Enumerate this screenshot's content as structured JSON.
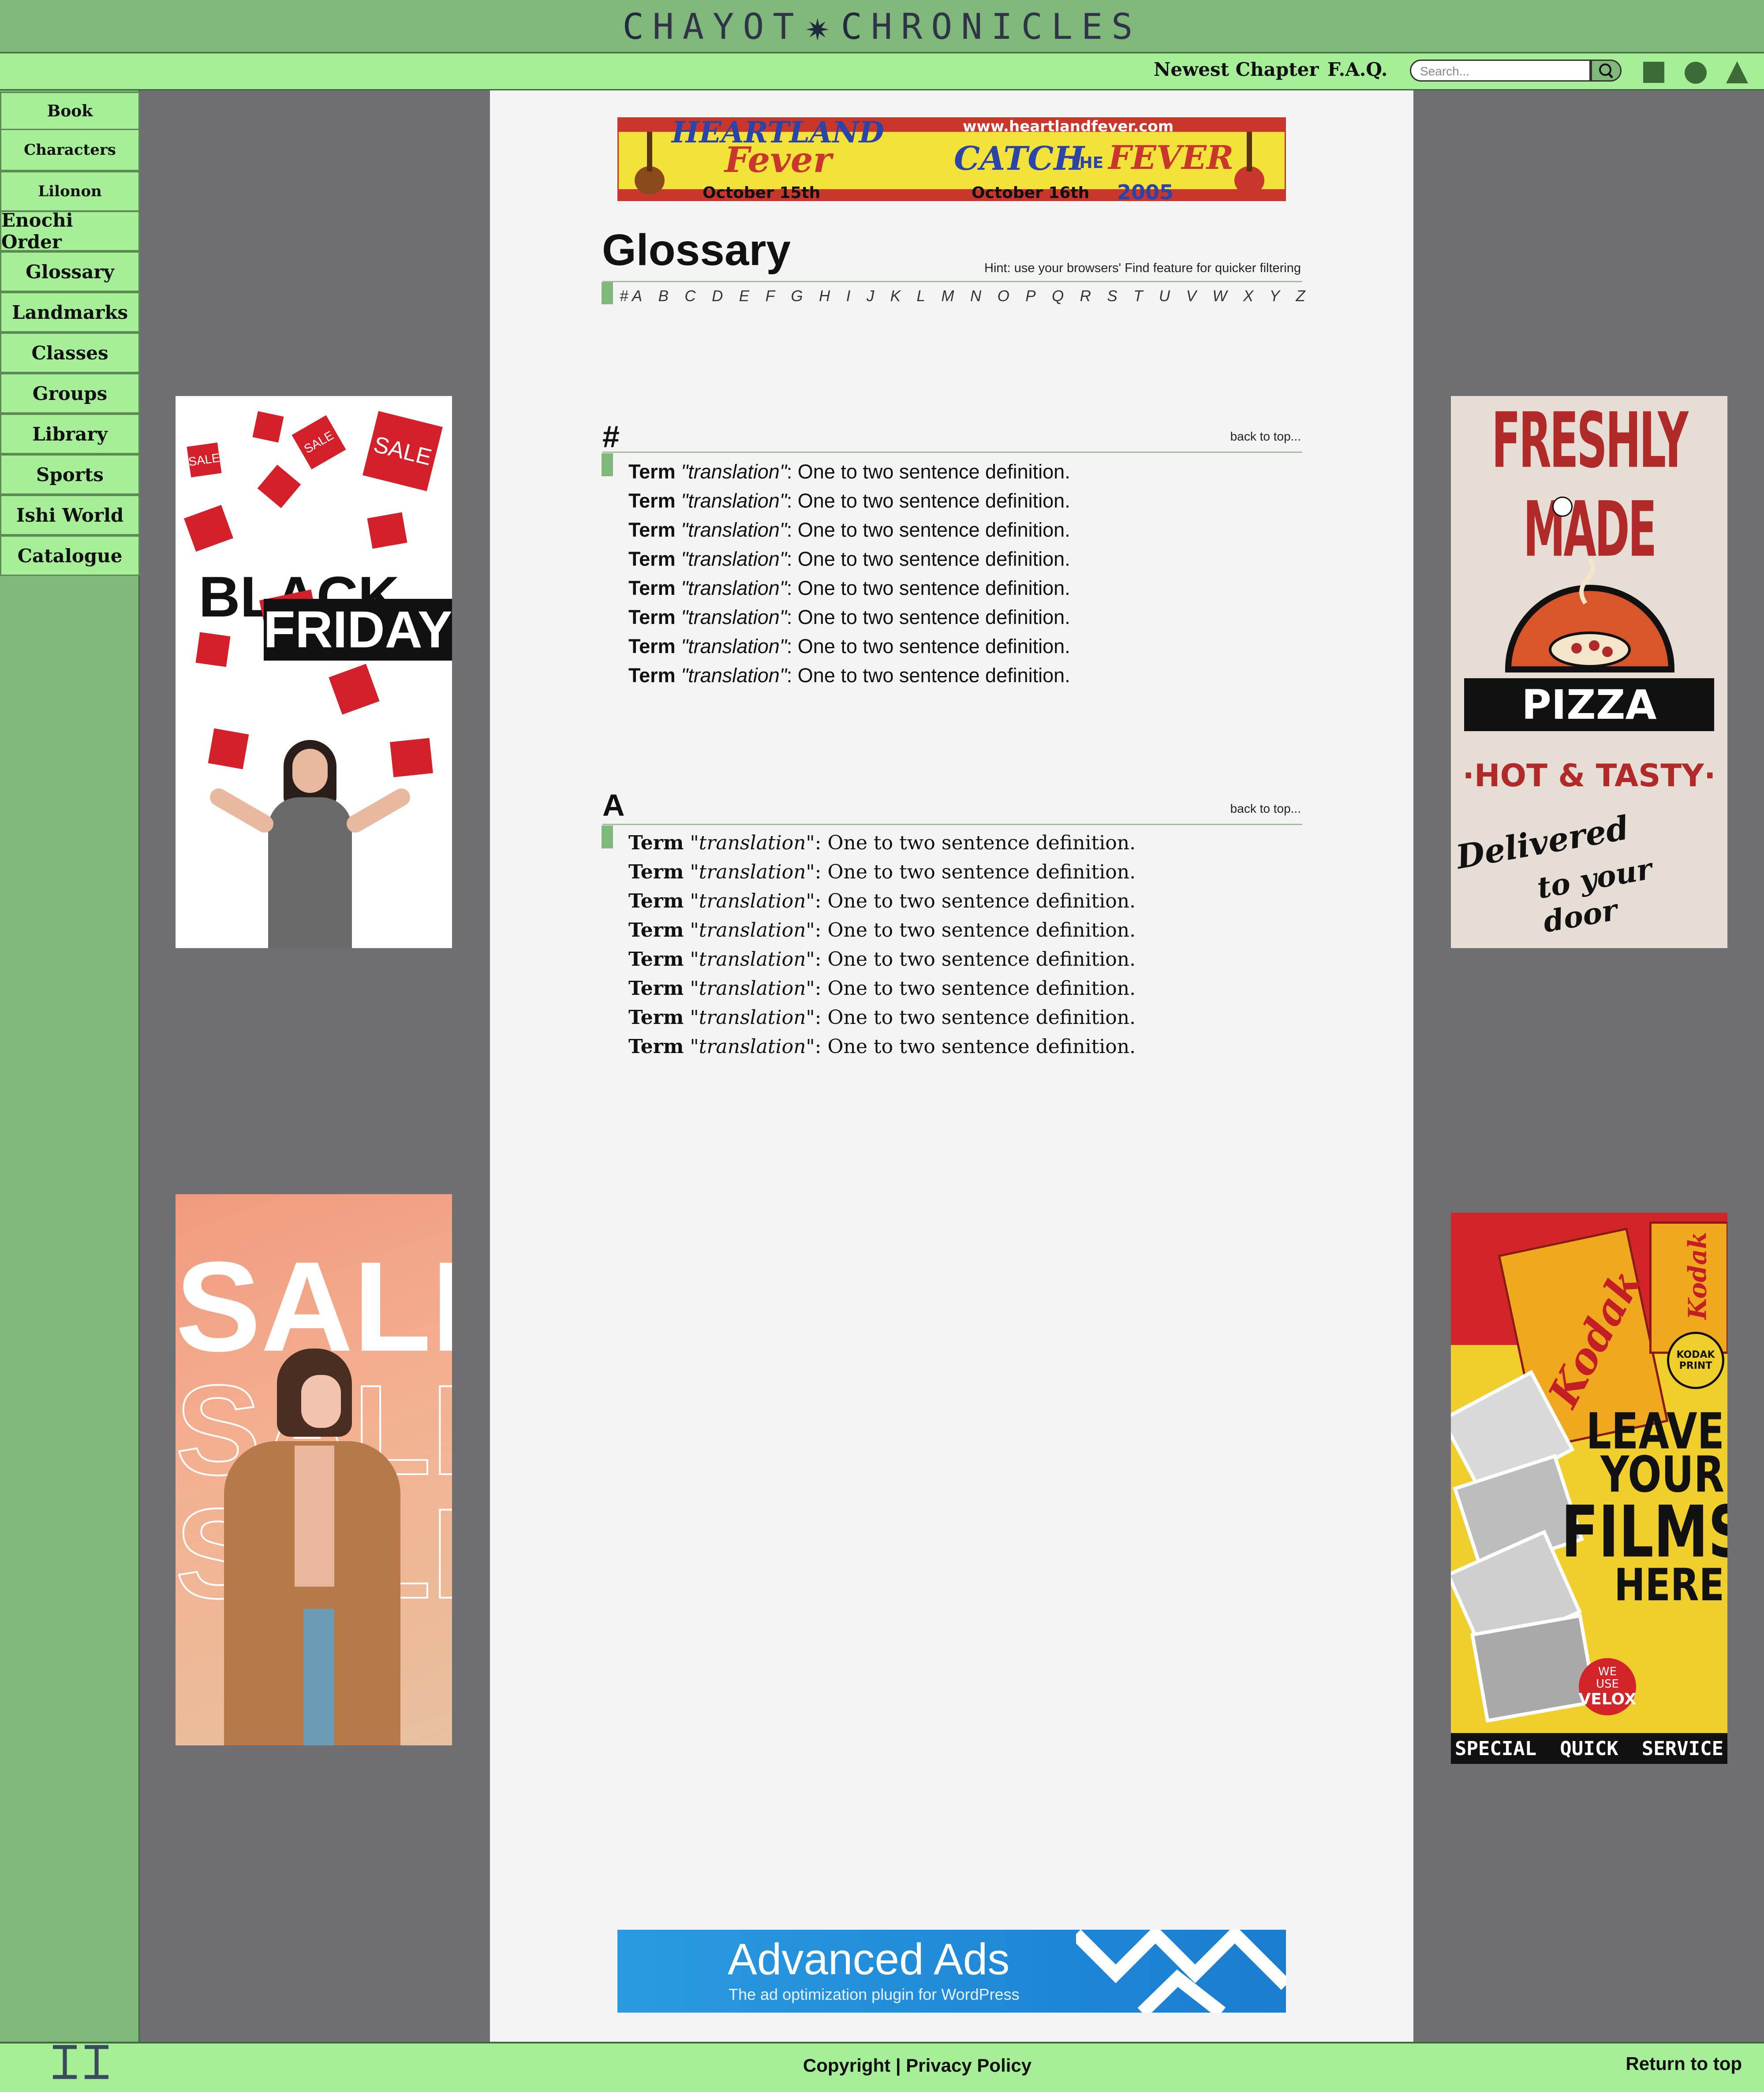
{
  "header": {
    "title_parts": [
      "C",
      "HAYOT",
      "✷",
      "C",
      "HRONICLES"
    ],
    "nav": {
      "newest_chapter": "Newest Chapter",
      "faq": "F.A.Q."
    },
    "search_placeholder": "Search...",
    "icons": [
      "search-icon",
      "square-icon",
      "circle-icon",
      "triangle-icon"
    ]
  },
  "sidebar": {
    "items": [
      "Book",
      "Characters",
      "Lilonon",
      "Enochi Order",
      "Glossary",
      "Landmarks",
      "Classes",
      "Groups",
      "Library",
      "Sports",
      "Ishi World",
      "Catalogue"
    ]
  },
  "ads": {
    "top_banner": {
      "line1": "HEARTLAND",
      "line2": "Fever",
      "url": "www.heartlandfever.com",
      "slogan_a": "CATCH",
      "slogan_b": "THE",
      "slogan_c": "FEVER",
      "date1": "October 15th",
      "date2": "October 16th",
      "year": "2005"
    },
    "left_top": {
      "sale": "SALE",
      "black": "BLACK",
      "friday": "FRIDAY"
    },
    "left_bottom": {
      "sale": "SALE"
    },
    "right_top": {
      "headline": "FRESHLY MADE",
      "product": "PIZZA",
      "tagline": "·HOT & TASTY·",
      "script1": "Delivered",
      "script2": "to your door"
    },
    "right_bottom": {
      "brand": "Kodak",
      "line1": "LEAVE",
      "line2": "YOUR",
      "line3": "FILMS",
      "line4": "HERE",
      "badge1": "WE",
      "badge2": "USE",
      "badge3": "VELOX",
      "footer": "SPECIAL  QUICK  SERVICE",
      "kprint": "KODAK PRINT"
    },
    "bottom_banner": {
      "title": "Advanced Ads",
      "subtitle": "The ad optimization plugin for WordPress"
    }
  },
  "glossary": {
    "title": "Glossary",
    "hint": "Hint: use your browsers' Find feature for quicker filtering",
    "letters": [
      "# A",
      "B",
      "C",
      "D",
      "E",
      "F",
      "G",
      "H",
      "I",
      "J",
      "K",
      "L",
      "M",
      "N",
      "O",
      "P",
      "Q",
      "R",
      "S",
      "T",
      "U",
      "V",
      "W",
      "X",
      "Y",
      "Z"
    ],
    "back_to_top": "back to top...",
    "sections": [
      {
        "heading": "#",
        "entries": [
          {
            "term": "Term",
            "translation": "\"translation\"",
            "definition": ": One to two sentence definition."
          },
          {
            "term": "Term",
            "translation": "\"translation\"",
            "definition": ": One to two sentence definition."
          },
          {
            "term": "Term",
            "translation": "\"translation\"",
            "definition": ": One to two sentence definition."
          },
          {
            "term": "Term",
            "translation": "\"translation\"",
            "definition": ": One to two sentence definition."
          },
          {
            "term": "Term",
            "translation": "\"translation\"",
            "definition": ": One to two sentence definition."
          },
          {
            "term": "Term",
            "translation": "\"translation\"",
            "definition": ": One to two sentence definition."
          },
          {
            "term": "Term",
            "translation": "\"translation\"",
            "definition": ": One to two sentence definition."
          },
          {
            "term": "Term",
            "translation": "\"translation\"",
            "definition": ": One to two sentence definition."
          }
        ]
      },
      {
        "heading": "A",
        "entries": [
          {
            "term": "Term",
            "translation": "\"translation\"",
            "definition": ": One to two sentence definition."
          },
          {
            "term": "Term",
            "translation": "\"translation\"",
            "definition": ": One to two sentence definition."
          },
          {
            "term": "Term",
            "translation": "\"translation\"",
            "definition": ": One to two sentence definition."
          },
          {
            "term": "Term",
            "translation": "\"translation\"",
            "definition": ": One to two sentence definition."
          },
          {
            "term": "Term",
            "translation": "\"translation\"",
            "definition": ": One to two sentence definition."
          },
          {
            "term": "Term",
            "translation": "\"translation\"",
            "definition": ": One to two sentence definition."
          },
          {
            "term": "Term",
            "translation": "\"translation\"",
            "definition": ": One to two sentence definition."
          },
          {
            "term": "Term",
            "translation": "\"translation\"",
            "definition": ": One to two sentence definition."
          }
        ]
      }
    ]
  },
  "footer": {
    "copyright": "Copyright",
    "separator": " | ",
    "privacy": "Privacy Policy",
    "return_top": "Return to top"
  },
  "colors": {
    "header_green": "#80b77a",
    "nav_light_green": "#a6ee97",
    "gutter_gray": "#6f6e72",
    "content_bg": "#f4f4f4"
  }
}
